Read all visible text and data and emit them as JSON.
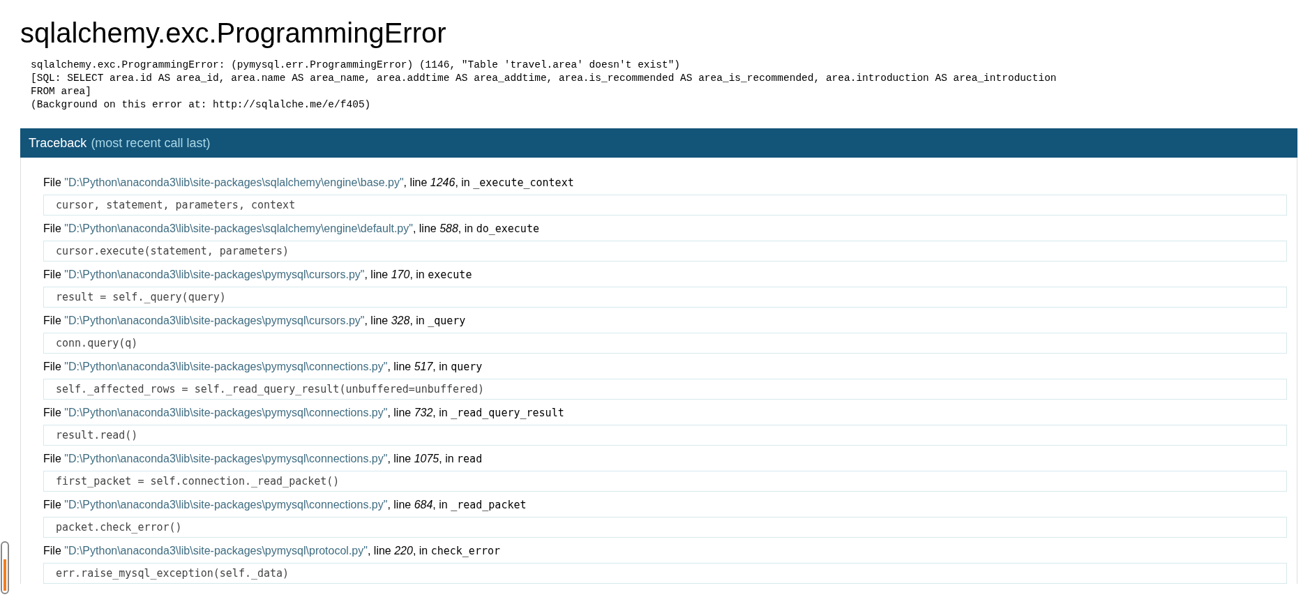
{
  "title": "sqlalchemy.exc.ProgrammingError",
  "message_lines": [
    "sqlalchemy.exc.ProgrammingError: (pymysql.err.ProgrammingError) (1146, \"Table 'travel.area' doesn't exist\")",
    "[SQL: SELECT area.id AS area_id, area.name AS area_name, area.addtime AS area_addtime, area.is_recommended AS area_is_recommended, area.introduction AS area_introduction",
    "FROM area]",
    "(Background on this error at: http://sqlalche.me/e/f405)"
  ],
  "traceback": {
    "title": "Traceback",
    "subtitle": "(most recent call last)",
    "frames": [
      {
        "prefix": "File",
        "path": "\"D:\\Python\\anaconda3\\lib\\site-packages\\sqlalchemy\\engine\\base.py\"",
        "line_label": ", line",
        "line": "1246",
        "in_label": ", in",
        "function": "_execute_context",
        "code": "cursor, statement, parameters, context"
      },
      {
        "prefix": "File",
        "path": "\"D:\\Python\\anaconda3\\lib\\site-packages\\sqlalchemy\\engine\\default.py\"",
        "line_label": ", line",
        "line": "588",
        "in_label": ", in",
        "function": "do_execute",
        "code": "cursor.execute(statement, parameters)"
      },
      {
        "prefix": "File",
        "path": "\"D:\\Python\\anaconda3\\lib\\site-packages\\pymysql\\cursors.py\"",
        "line_label": ", line",
        "line": "170",
        "in_label": ", in",
        "function": "execute",
        "code": "result = self._query(query)"
      },
      {
        "prefix": "File",
        "path": "\"D:\\Python\\anaconda3\\lib\\site-packages\\pymysql\\cursors.py\"",
        "line_label": ", line",
        "line": "328",
        "in_label": ", in",
        "function": "_query",
        "code": "conn.query(q)"
      },
      {
        "prefix": "File",
        "path": "\"D:\\Python\\anaconda3\\lib\\site-packages\\pymysql\\connections.py\"",
        "line_label": ", line",
        "line": "517",
        "in_label": ", in",
        "function": "query",
        "code": "self._affected_rows = self._read_query_result(unbuffered=unbuffered)"
      },
      {
        "prefix": "File",
        "path": "\"D:\\Python\\anaconda3\\lib\\site-packages\\pymysql\\connections.py\"",
        "line_label": ", line",
        "line": "732",
        "in_label": ", in",
        "function": "_read_query_result",
        "code": "result.read()"
      },
      {
        "prefix": "File",
        "path": "\"D:\\Python\\anaconda3\\lib\\site-packages\\pymysql\\connections.py\"",
        "line_label": ", line",
        "line": "1075",
        "in_label": ", in",
        "function": "read",
        "code": "first_packet = self.connection._read_packet()"
      },
      {
        "prefix": "File",
        "path": "\"D:\\Python\\anaconda3\\lib\\site-packages\\pymysql\\connections.py\"",
        "line_label": ", line",
        "line": "684",
        "in_label": ", in",
        "function": "_read_packet",
        "code": "packet.check_error()"
      },
      {
        "prefix": "File",
        "path": "\"D:\\Python\\anaconda3\\lib\\site-packages\\pymysql\\protocol.py\"",
        "line_label": ", line",
        "line": "220",
        "in_label": ", in",
        "function": "check_error",
        "code": "err.raise_mysql_exception(self._data)"
      }
    ]
  }
}
